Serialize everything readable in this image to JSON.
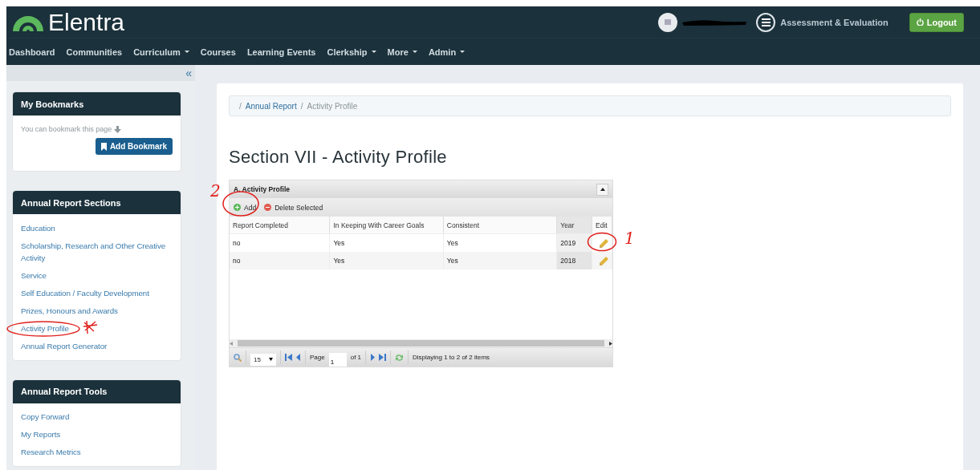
{
  "header": {
    "brand": "Elentra",
    "app_link": "Assessment & Evaluation",
    "logout": "Logout"
  },
  "nav": [
    {
      "label": "Dashboard",
      "dropdown": false
    },
    {
      "label": "Communities",
      "dropdown": false
    },
    {
      "label": "Curriculum",
      "dropdown": true
    },
    {
      "label": "Courses",
      "dropdown": false
    },
    {
      "label": "Learning Events",
      "dropdown": false
    },
    {
      "label": "Clerkship",
      "dropdown": true
    },
    {
      "label": "More",
      "dropdown": true
    },
    {
      "label": "Admin",
      "dropdown": true
    }
  ],
  "sidebar": {
    "collapse": "«",
    "bookmarks": {
      "title": "My Bookmarks",
      "hint": "You can bookmark this page",
      "button": "Add Bookmark"
    },
    "sections": [
      {
        "title": "Annual Report Sections",
        "items": [
          "Education",
          "Scholarship, Research and Other Creative Activity",
          "Service",
          "Self Education / Faculty Development",
          "Prizes, Honours and Awards",
          "Activity Profile",
          "Annual Report Generator"
        ]
      },
      {
        "title": "Annual Report Tools",
        "items": [
          "Copy Forward",
          "My Reports",
          "Research Metrics"
        ]
      }
    ]
  },
  "breadcrumb": {
    "separator": "/",
    "items": [
      {
        "label": "Annual Report",
        "link": true
      },
      {
        "label": "Activity Profile",
        "link": false
      }
    ]
  },
  "heading": "Section VII - Activity Profile",
  "grid": {
    "title": "A. Activity Profile",
    "add": "Add",
    "delete": "Delete Selected",
    "columns": [
      {
        "label": "Report Completed",
        "sorted": false
      },
      {
        "label": "In Keeping With Career Goals",
        "sorted": false
      },
      {
        "label": "Consistent",
        "sorted": false
      },
      {
        "label": "Year",
        "sorted": true
      },
      {
        "label": "Edit",
        "sorted": false
      }
    ],
    "rows": [
      [
        "no",
        "Yes",
        "Yes",
        "2019"
      ],
      [
        "no",
        "Yes",
        "Yes",
        "2018"
      ]
    ],
    "pager": {
      "page_size": "15",
      "page_label": "Page",
      "page": "1",
      "of": "of 1",
      "status": "Displaying 1 to 2 of 2 items"
    }
  },
  "annotations": [
    {
      "label": "2"
    },
    {
      "label": "1"
    }
  ]
}
